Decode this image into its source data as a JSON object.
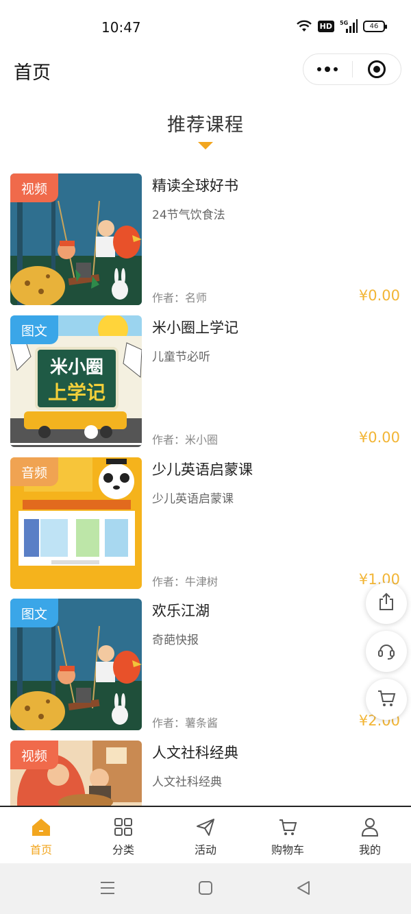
{
  "status_bar": {
    "time": "10:47",
    "hd_label": "HD",
    "network_label": "5G",
    "battery_level": "46"
  },
  "nav": {
    "title": "首页"
  },
  "section": {
    "title": "推荐课程"
  },
  "courses": [
    {
      "badge": "视频",
      "badge_color": "#f06a4b",
      "title": "精读全球好书",
      "subtitle": "24节气饮食法",
      "author": "作者：名师",
      "price": "¥0.00"
    },
    {
      "badge": "图文",
      "badge_color": "#3aa6e8",
      "title": "米小圈上学记",
      "subtitle": "儿童节必听",
      "author": "作者：米小圈",
      "price": "¥0.00"
    },
    {
      "badge": "音频",
      "badge_color": "#f0a352",
      "title": "少儿英语启蒙课",
      "subtitle": "少儿英语启蒙课",
      "author": "作者：牛津树",
      "price": "¥1.00"
    },
    {
      "badge": "图文",
      "badge_color": "#3aa6e8",
      "title": "欢乐江湖",
      "subtitle": "奇葩快报",
      "author": "作者：薯条酱",
      "price": "¥2.00"
    },
    {
      "badge": "视频",
      "badge_color": "#f06a4b",
      "title": "人文社科经典",
      "subtitle": "人文社科经典",
      "author": "",
      "price": ""
    }
  ],
  "cover_art": {
    "mixiaoquan_line1": "米小圈",
    "mixiaoquan_line2": "上学记"
  },
  "floating": {
    "share_icon": "share-icon",
    "service_icon": "headset-icon",
    "cart_icon": "cart-icon"
  },
  "tabs": [
    {
      "label": "首页",
      "icon": "home-icon",
      "active": true
    },
    {
      "label": "分类",
      "icon": "grid-icon",
      "active": false
    },
    {
      "label": "活动",
      "icon": "paper-plane-icon",
      "active": false
    },
    {
      "label": "购物车",
      "icon": "cart-icon",
      "active": false
    },
    {
      "label": "我的",
      "icon": "user-icon",
      "active": false
    }
  ],
  "colors": {
    "accent": "#f2a61f",
    "price": "#f2b535",
    "video_badge": "#f06a4b",
    "text_badge": "#3aa6e8",
    "audio_badge": "#f0a352"
  }
}
